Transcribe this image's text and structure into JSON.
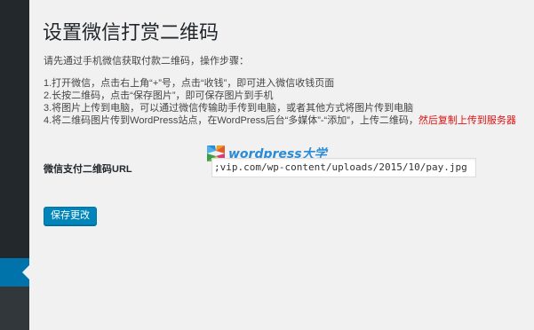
{
  "page": {
    "title": "设置微信打赏二维码",
    "intro": "请先通过手机微信获取付款二维码，操作步骤："
  },
  "steps": [
    "1.打开微信，点击右上角“+”号，点击“收钱”，即可进入微信收钱页面",
    "2.长按二维码，点击“保存图片”，即可保存图片到手机",
    "3.将图片上传到电脑，可以通过微信传输助手传到电脑，或者其他方式将图片传到电脑"
  ],
  "step4": {
    "text": "4.将二维码图片传到WordPress站点，在WordPress后台“多媒体”-“添加”，上传二维码，",
    "warning": "然后复制上传到服务器",
    "warning_color": "#dd1111"
  },
  "watermark": {
    "text": "wordpress大学",
    "icon": "wordpress-daxue-logo-icon"
  },
  "form": {
    "url_label": "微信支付二维码URL",
    "url_value": ";vip.com/wp-content/uploads/2015/10/pay.jpg"
  },
  "actions": {
    "save_label": "保存更改"
  },
  "colors": {
    "sidebar": "#23282d",
    "accent": "#0073aa",
    "button": "#0085ba",
    "background": "#f1f1f1"
  }
}
